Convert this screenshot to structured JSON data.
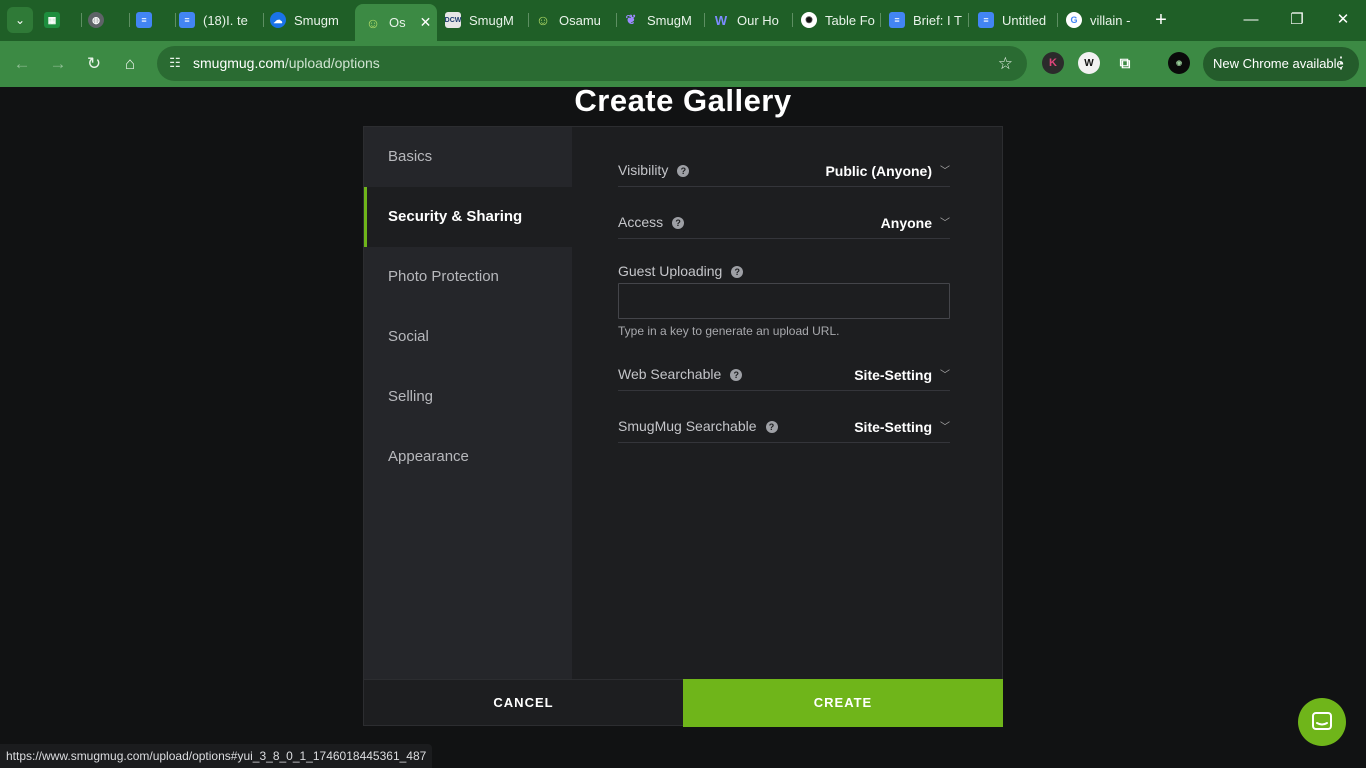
{
  "browser": {
    "tabs": [
      {
        "title": "",
        "favicon": "sheets-icon",
        "color": "#1e8e3e"
      },
      {
        "title": "",
        "favicon": "globe-icon",
        "color": "#5f6368"
      },
      {
        "title": "",
        "favicon": "docs-icon",
        "color": "#4285f4"
      },
      {
        "title": "(18)I. te",
        "favicon": "docs-icon",
        "color": "#4285f4"
      },
      {
        "title": "Smugm",
        "favicon": "cloud-icon",
        "color": "#1a73e8"
      },
      {
        "title": "Os",
        "favicon": "smugmug-icon",
        "color": "#6fb51a",
        "active": true
      },
      {
        "title": "SmugM",
        "favicon": "dcw-icon",
        "color": "#ffffff"
      },
      {
        "title": "Osamu",
        "favicon": "smugmug-icon",
        "color": "#6fb51a"
      },
      {
        "title": "SmugM",
        "favicon": "feather-icon",
        "color": "#7b61ff"
      },
      {
        "title": "Our Ho",
        "favicon": "w-icon",
        "color": "#5b6cff"
      },
      {
        "title": "Table Fo",
        "favicon": "openai-icon",
        "color": "#ffffff"
      },
      {
        "title": "Brief: I T",
        "favicon": "docs-icon",
        "color": "#4285f4"
      },
      {
        "title": "Untitled",
        "favicon": "docs-icon",
        "color": "#4285f4"
      },
      {
        "title": "villain -",
        "favicon": "google-icon",
        "color": "#ffffff"
      }
    ],
    "url_host": "smugmug.com",
    "url_path": "/upload/options",
    "update_label": "New Chrome available"
  },
  "page": {
    "title": "Create Gallery",
    "nav": [
      {
        "label": "Basics"
      },
      {
        "label": "Security & Sharing",
        "active": true
      },
      {
        "label": "Photo Protection"
      },
      {
        "label": "Social"
      },
      {
        "label": "Selling"
      },
      {
        "label": "Appearance"
      }
    ],
    "fields": {
      "visibility": {
        "label": "Visibility",
        "value": "Public (Anyone)"
      },
      "access": {
        "label": "Access",
        "value": "Anyone"
      },
      "guest_uploading": {
        "label": "Guest Uploading",
        "value": "",
        "hint": "Type in a key to generate an upload URL."
      },
      "web_searchable": {
        "label": "Web Searchable",
        "value": "Site-Setting"
      },
      "smugmug_searchable": {
        "label": "SmugMug Searchable",
        "value": "Site-Setting"
      }
    },
    "cancel_label": "CANCEL",
    "create_label": "CREATE",
    "status_url": "https://www.smugmug.com/upload/options#yui_3_8_0_1_1746018445361_487"
  },
  "colors": {
    "accent": "#6fb51a",
    "chrome_frame": "#1f5f27",
    "background": "#111213"
  }
}
